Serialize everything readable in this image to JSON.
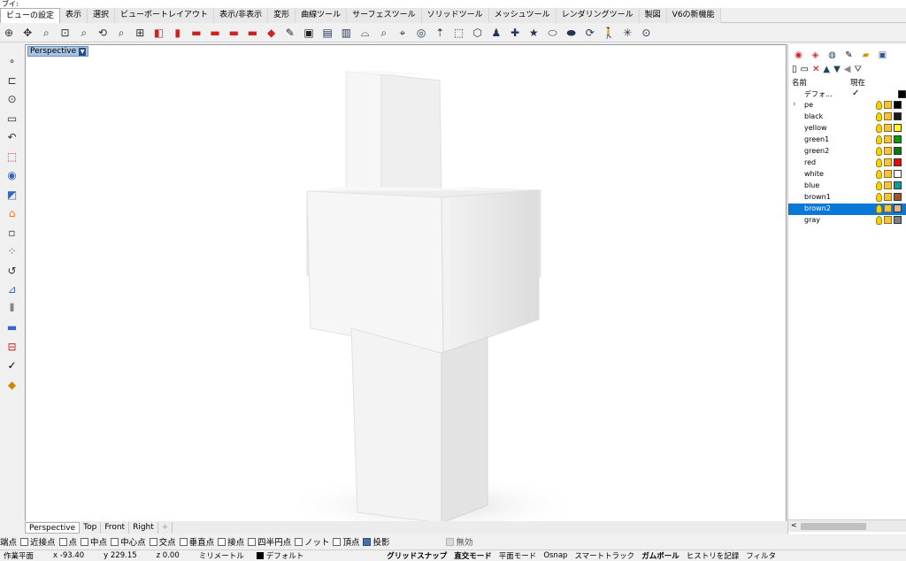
{
  "command_line": "ブイ:",
  "tabs": [
    "ビューの設定",
    "表示",
    "選択",
    "ビューポートレイアウト",
    "表示/非表示",
    "変形",
    "曲線ツール",
    "サーフェスツール",
    "ソリッドツール",
    "メッシュツール",
    "レンダリングツール",
    "製図",
    "V6の新機能"
  ],
  "active_tab": "ビューの設定",
  "toolbar_icons": [
    "⊕",
    "✥",
    "⌕",
    "⊡",
    "⌕",
    "⟲",
    "⌕",
    "⊞",
    "◧",
    "▮",
    "▬",
    "▬",
    "▬",
    "▬",
    "◆",
    "✎",
    "▣",
    "▤",
    "▥",
    "⌓",
    "⌕",
    "⌖",
    "◎",
    "⇡",
    "⬚",
    "⬡",
    "♟",
    "✚",
    "★",
    "⬭",
    "⬬",
    "⟳",
    "🚶",
    "✳",
    "⊙"
  ],
  "left_tools": [
    "∘",
    "⊏",
    "⊙",
    "▭",
    "↶",
    "⬚",
    "◉",
    "◩",
    "⌂",
    "▫",
    "⁘",
    "↺",
    "⊿",
    "⫴",
    "▬",
    "⊟",
    "✓",
    "◆"
  ],
  "viewport": {
    "title": "Perspective",
    "tabs": [
      "Perspective",
      "Top",
      "Front",
      "Right"
    ],
    "add_tab": "+"
  },
  "osnap": [
    {
      "label": "端点",
      "checked": true
    },
    {
      "label": "近接点",
      "checked": false
    },
    {
      "label": "点",
      "checked": false
    },
    {
      "label": "中点",
      "checked": false
    },
    {
      "label": "中心点",
      "checked": false
    },
    {
      "label": "交点",
      "checked": false
    },
    {
      "label": "垂直点",
      "checked": false
    },
    {
      "label": "接点",
      "checked": false
    },
    {
      "label": "四半円点",
      "checked": false
    },
    {
      "label": "ノット",
      "checked": false
    },
    {
      "label": "頂点",
      "checked": false
    },
    {
      "label": "投影",
      "checked": true
    },
    {
      "label": "無効",
      "checked": false,
      "disabled": true
    }
  ],
  "status": {
    "plane": "作業平面",
    "x": "x -93.40",
    "y": "y 229.15",
    "z": "z 0.00",
    "units": "ミリメートル",
    "layer": "デフォルト",
    "grid_snap": "グリッドスナップ",
    "ortho": "直交モード",
    "planar": "平面モード",
    "osnap": "Osnap",
    "smart_track": "スマートトラック",
    "gumball": "ガムボール",
    "history": "ヒストリを記録",
    "filter": "フィルタ"
  },
  "layers_panel": {
    "header_name": "名前",
    "header_current": "現在",
    "items": [
      {
        "name": "デフォ...",
        "current": true,
        "color": "#000000",
        "expand": false
      },
      {
        "name": "pe",
        "color": "#000000",
        "expand": true
      },
      {
        "name": "black",
        "color": "#1a1a1a"
      },
      {
        "name": "yellow",
        "color": "#ffff00"
      },
      {
        "name": "green1",
        "color": "#00a000"
      },
      {
        "name": "green2",
        "color": "#008000"
      },
      {
        "name": "red",
        "color": "#ff0000"
      },
      {
        "name": "white",
        "color": "#ffffff"
      },
      {
        "name": "blue",
        "color": "#00a0a0"
      },
      {
        "name": "brown1",
        "color": "#a0522d"
      },
      {
        "name": "brown2",
        "color": "#deb887",
        "selected": true
      },
      {
        "name": "gray",
        "color": "#808080"
      }
    ]
  },
  "scroll_left_arrow": "<"
}
